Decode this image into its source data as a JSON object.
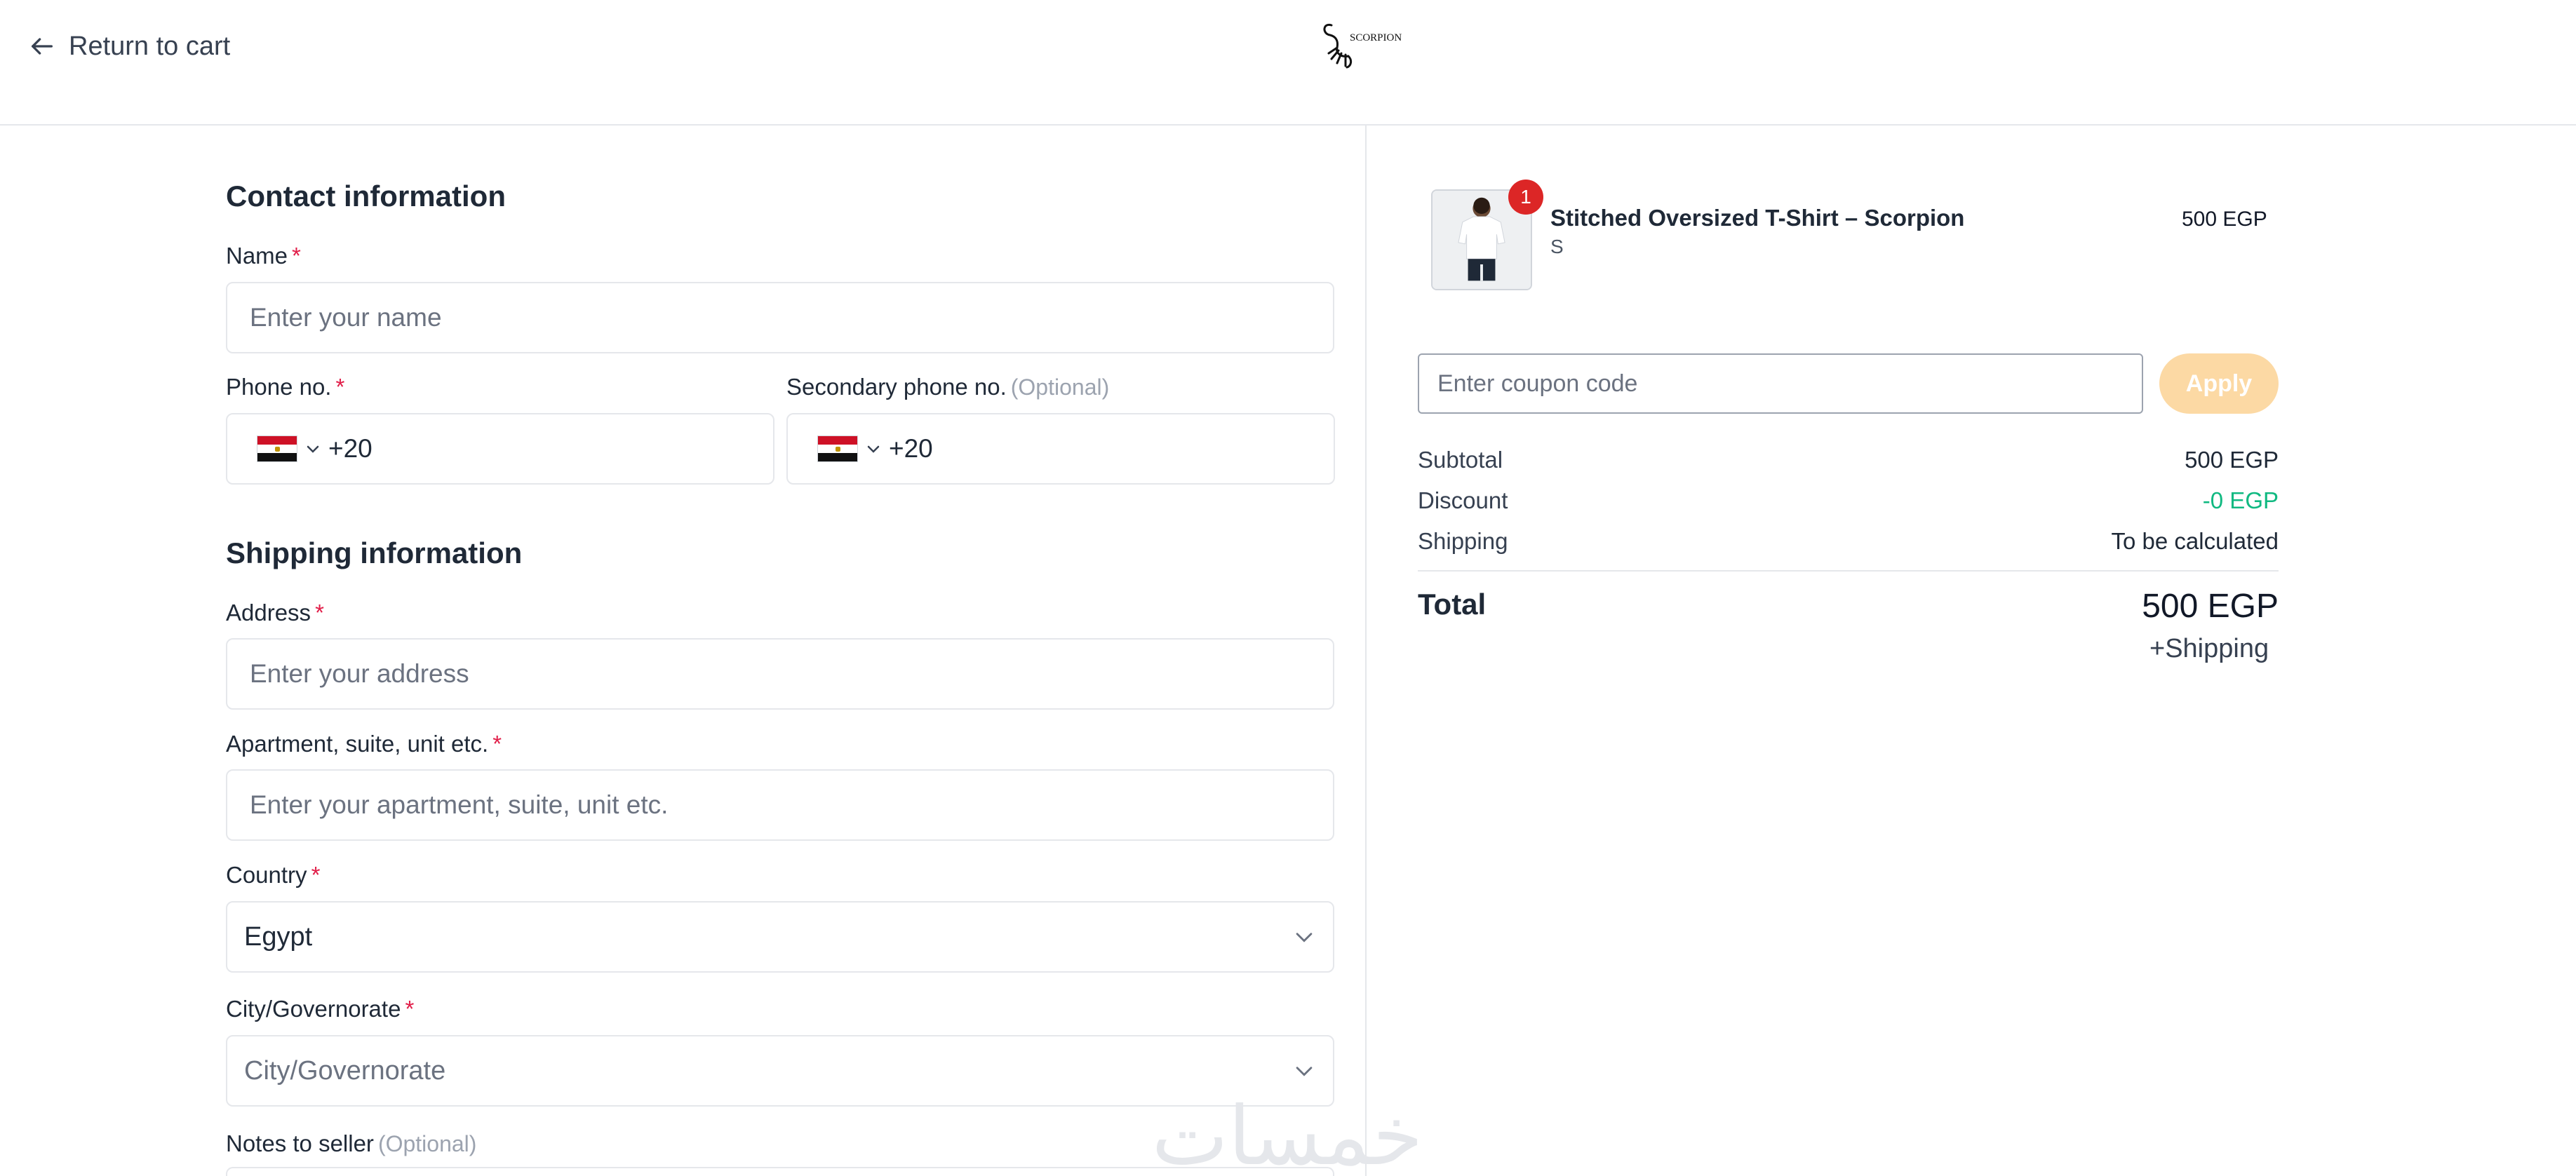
{
  "header": {
    "back_label": "Return to cart",
    "logo_text": "SCORPION"
  },
  "contact": {
    "title": "Contact information",
    "name": {
      "label": "Name",
      "required": "*",
      "placeholder": "Enter your name"
    },
    "phone": {
      "label": "Phone no.",
      "required": "*",
      "dial_code": "+20"
    },
    "secondary_phone": {
      "label": "Secondary phone no.",
      "optional": "(Optional)",
      "dial_code": "+20"
    }
  },
  "shipping": {
    "title": "Shipping information",
    "address": {
      "label": "Address",
      "required": "*",
      "placeholder": "Enter your address"
    },
    "apartment": {
      "label": "Apartment, suite, unit etc.",
      "required": "*",
      "placeholder": "Enter your apartment, suite, unit etc."
    },
    "country": {
      "label": "Country",
      "required": "*",
      "value": "Egypt"
    },
    "city": {
      "label": "City/Governorate",
      "required": "*",
      "placeholder": "City/Governorate"
    },
    "notes": {
      "label": "Notes to seller",
      "optional": "(Optional)"
    }
  },
  "order": {
    "item": {
      "name": "Stitched Oversized T-Shirt – Scorpion",
      "variant": "S",
      "price": "500 EGP",
      "quantity": "1"
    },
    "coupon": {
      "placeholder": "Enter coupon code",
      "apply_label": "Apply"
    },
    "subtotal": {
      "label": "Subtotal",
      "value": "500 EGP"
    },
    "discount": {
      "label": "Discount",
      "value": "-0 EGP"
    },
    "shipping": {
      "label": "Shipping",
      "value": "To be calculated"
    },
    "total": {
      "label": "Total",
      "value": "500 EGP",
      "note": "+Shipping"
    }
  },
  "watermark": "خمسات",
  "colors": {
    "required": "#e11d48",
    "discount": "#10b981",
    "apply_button": "#fcd9a4",
    "badge": "#dc2626",
    "border": "#e5e7eb"
  }
}
